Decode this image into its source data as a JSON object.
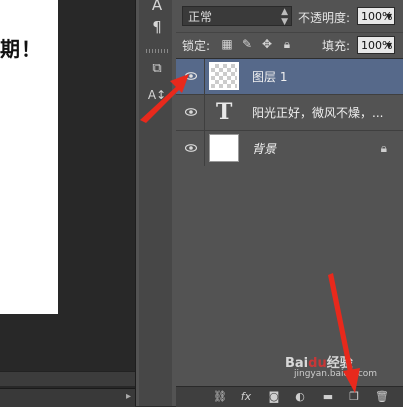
{
  "document": {
    "visible_text": "期！"
  },
  "tools": {
    "items": [
      "A",
      "¶",
      "⧉",
      "A↕"
    ]
  },
  "blend": {
    "mode": "正常"
  },
  "opacity": {
    "label": "不透明度:",
    "value": "100%"
  },
  "lock": {
    "label": "锁定:"
  },
  "fill": {
    "label": "填充:",
    "value": "100%"
  },
  "layers": [
    {
      "name": "图层 1",
      "kind": "raster",
      "selected": true
    },
    {
      "name": "阳光正好，微风不燥，...",
      "kind": "text",
      "selected": false
    },
    {
      "name": "背景",
      "kind": "background",
      "selected": false,
      "locked": true
    }
  ],
  "footer": {
    "icons": [
      "link-icon",
      "fx-icon",
      "mask-icon",
      "adjustment-icon",
      "folder-icon",
      "new-layer-icon",
      "trash-icon"
    ],
    "fx_label": "fx"
  },
  "watermark": {
    "logo_text": "Baidu经验",
    "url": "jingyan.baidu.com"
  },
  "colors": {
    "panel": "#535353",
    "selected_layer": "#56698a",
    "arrow": "#e8291c"
  }
}
